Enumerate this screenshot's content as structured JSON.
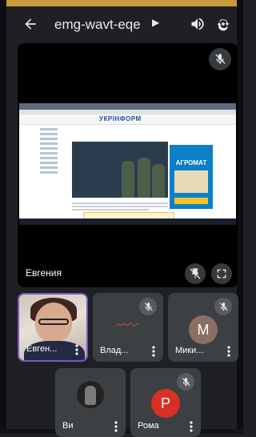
{
  "header": {
    "back_icon": "arrow-left-icon",
    "meeting_code": "emg-wavt-eqe",
    "arrow_icon": "triangle-right-icon",
    "speaker_icon": "speaker-icon",
    "switch_camera_icon": "switch-camera-icon"
  },
  "main": {
    "presenter_name": "Евгения",
    "mic_icon": "mic-off-icon",
    "pin_icon": "unpin-icon",
    "fullscreen_icon": "fullscreen-icon",
    "shared_screen": {
      "site_name": "УКРІНФОРМ",
      "ad_title": "АГРОМАТ"
    }
  },
  "participants": [
    {
      "name": "Евген...",
      "type": "video",
      "active": true,
      "muted": false
    },
    {
      "name": "Влад...",
      "type": "logo",
      "muted": true
    },
    {
      "name": "Мики...",
      "type": "letter",
      "letter": "M",
      "avatar_color": "#8d6e63",
      "muted": true
    },
    {
      "name": "Ви",
      "type": "photo",
      "muted": false
    },
    {
      "name": "Рома",
      "type": "letter",
      "letter": "P",
      "avatar_color": "#d93025",
      "muted": true
    }
  ],
  "colors": {
    "background": "#1f2023",
    "tile": "#3c4043",
    "active_border": "#7e57c2"
  }
}
